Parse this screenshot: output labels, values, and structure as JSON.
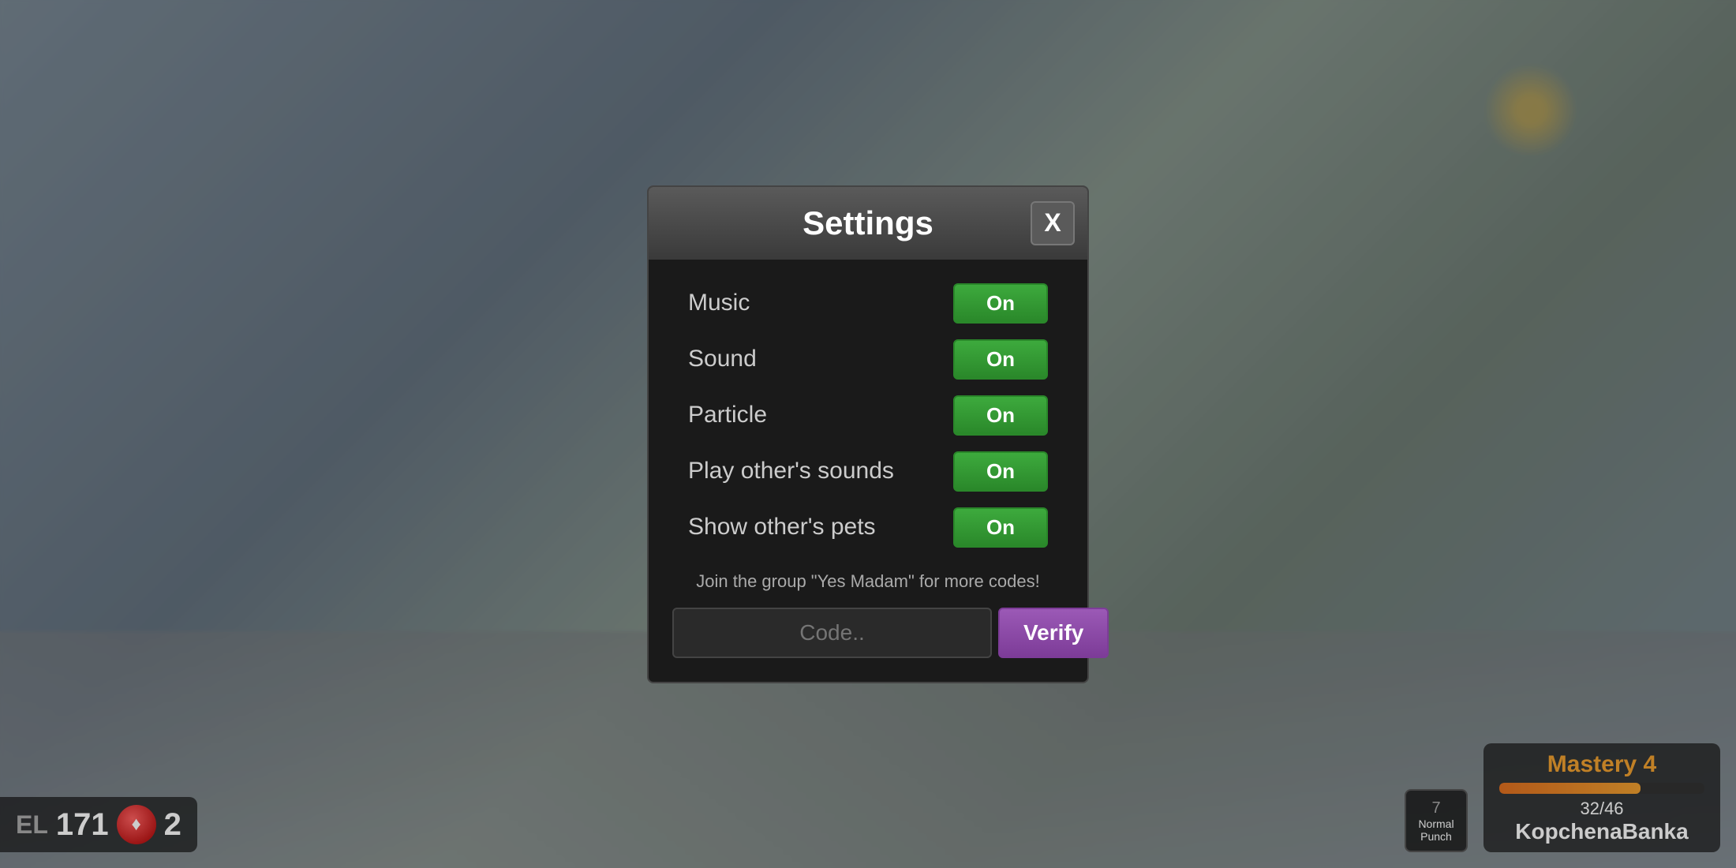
{
  "background": {
    "color": "#6b7b8a"
  },
  "hud": {
    "level_label": "EL",
    "coins": "171",
    "gems": "2",
    "mastery": {
      "title": "Mastery 4",
      "current": "32",
      "max": "46",
      "progress_percent": 69,
      "player_name": "KopchenaBanka"
    },
    "skill": {
      "number": "7",
      "name": "Normal Punch"
    }
  },
  "modal": {
    "title": "Settings",
    "close_label": "X",
    "settings": [
      {
        "label": "Music",
        "value": "On",
        "id": "music"
      },
      {
        "label": "Sound",
        "value": "On",
        "id": "sound"
      },
      {
        "label": "Particle",
        "value": "On",
        "id": "particle"
      },
      {
        "label": "Play other's sounds",
        "value": "On",
        "id": "play-others-sounds"
      },
      {
        "label": "Show other's pets",
        "value": "On",
        "id": "show-others-pets"
      }
    ],
    "group_notice": "Join the group \"Yes Madam\" for more codes!",
    "code_placeholder": "Code..",
    "verify_label": "Verify"
  }
}
